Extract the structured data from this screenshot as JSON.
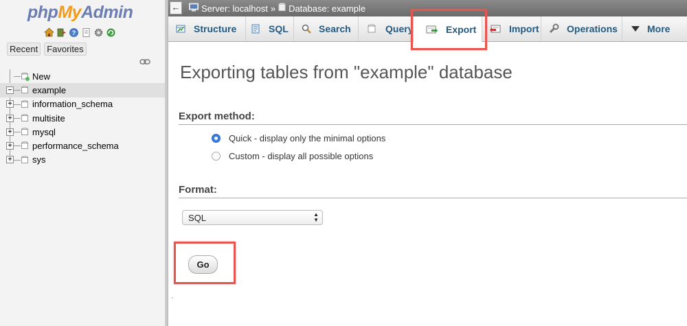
{
  "logo": {
    "php": "php",
    "my": "My",
    "admin": "Admin"
  },
  "sidebar": {
    "quick_icons": [
      "home-icon",
      "logout-icon",
      "help-icon",
      "docs-icon",
      "settings-icon",
      "reload-icon"
    ],
    "buttons": {
      "recent": "Recent",
      "favorites": "Favorites"
    },
    "tree": [
      {
        "label": "New",
        "type": "new"
      },
      {
        "label": "example",
        "type": "db",
        "expanded": true,
        "selected": true
      },
      {
        "label": "information_schema",
        "type": "db"
      },
      {
        "label": "multisite",
        "type": "db"
      },
      {
        "label": "mysql",
        "type": "db"
      },
      {
        "label": "performance_schema",
        "type": "db"
      },
      {
        "label": "sys",
        "type": "db"
      }
    ]
  },
  "breadcrumb": {
    "server": "Server: localhost",
    "separator": "»",
    "database": "Database: example"
  },
  "tabs": [
    {
      "label": "Structure",
      "icon": "structure-icon"
    },
    {
      "label": "SQL",
      "icon": "sql-icon"
    },
    {
      "label": "Search",
      "icon": "search-icon"
    },
    {
      "label": "Query",
      "icon": "query-icon"
    },
    {
      "label": "Export",
      "icon": "export-icon",
      "active": true
    },
    {
      "label": "Import",
      "icon": "import-icon"
    },
    {
      "label": "Operations",
      "icon": "operations-icon"
    },
    {
      "label": "More",
      "icon": "more-icon"
    }
  ],
  "content": {
    "title": "Exporting tables from \"example\" database",
    "export_method": {
      "heading": "Export method:",
      "options": [
        {
          "label": "Quick - display only the minimal options",
          "checked": true
        },
        {
          "label": "Custom - display all possible options",
          "checked": false
        }
      ]
    },
    "format": {
      "heading": "Format:",
      "selected": "SQL"
    },
    "go_label": "Go"
  },
  "colors": {
    "tab_text": "#235a81",
    "highlight": "#e8544e",
    "radio_on": "#3a7de1"
  }
}
